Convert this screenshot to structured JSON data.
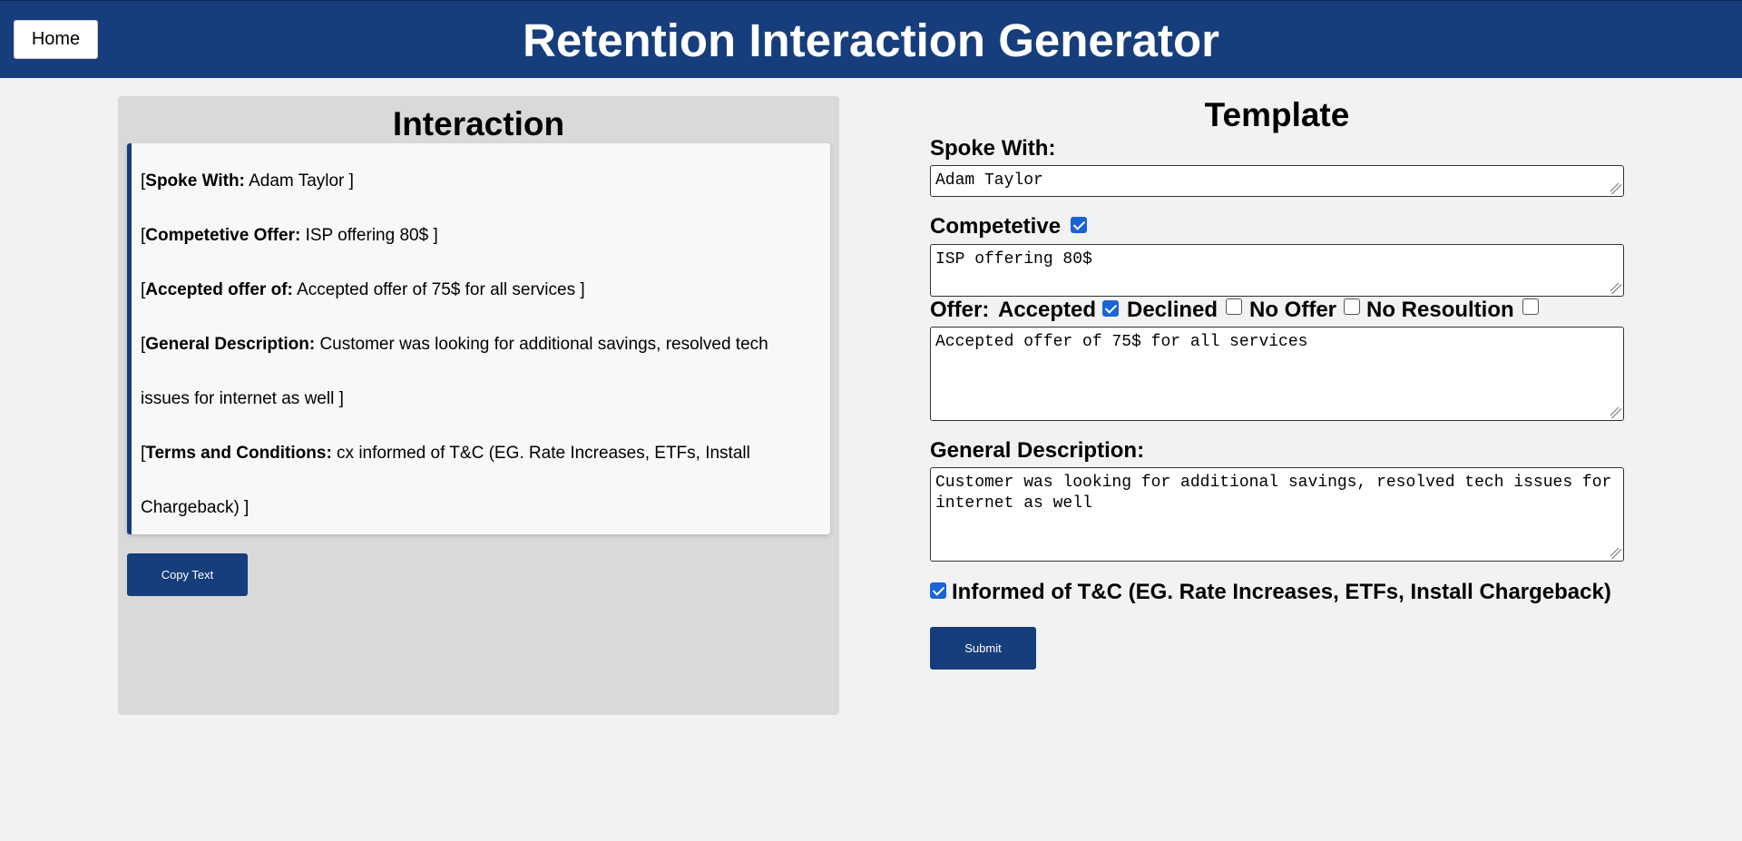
{
  "header": {
    "home_label": "Home",
    "title": "Retention Interaction Generator"
  },
  "interaction": {
    "title": "Interaction",
    "lines": [
      {
        "label": "Spoke With:",
        "value": "Adam Taylor"
      },
      {
        "label": "Competetive Offer:",
        "value": "ISP offering 80$"
      },
      {
        "label": "Accepted offer of:",
        "value": "Accepted offer of 75$ for all services"
      },
      {
        "label": "General Description:",
        "value": "Customer was looking for additional savings, resolved tech issues for internet as well"
      },
      {
        "label": "Terms and Conditions:",
        "value": "cx informed of T&C (EG. Rate Increases, ETFs, Install Chargeback)"
      }
    ],
    "copy_label": "Copy Text"
  },
  "template": {
    "title": "Template",
    "spoke_with_label": "Spoke With:",
    "spoke_with_value": "Adam Taylor",
    "competetive_label": "Competetive",
    "competetive_checked": true,
    "competetive_value": "ISP offering 80$",
    "offer_label": "Offer:",
    "offer_options": [
      {
        "label": "Accepted",
        "checked": true
      },
      {
        "label": "Declined",
        "checked": false
      },
      {
        "label": "No Offer",
        "checked": false
      },
      {
        "label": "No Resoultion",
        "checked": false
      }
    ],
    "offer_value": "Accepted offer of 75$ for all services",
    "general_label": "General Description:",
    "general_value": "Customer was looking for additional savings, resolved tech issues for internet as well",
    "tc_checked": true,
    "tc_label": "Informed of T&C (EG. Rate Increases, ETFs, Install Chargeback)",
    "submit_label": "Submit"
  },
  "colors": {
    "header_bg": "#163d7c",
    "button_bg": "#163d7c",
    "checkbox_checked": "#1a64d6"
  }
}
